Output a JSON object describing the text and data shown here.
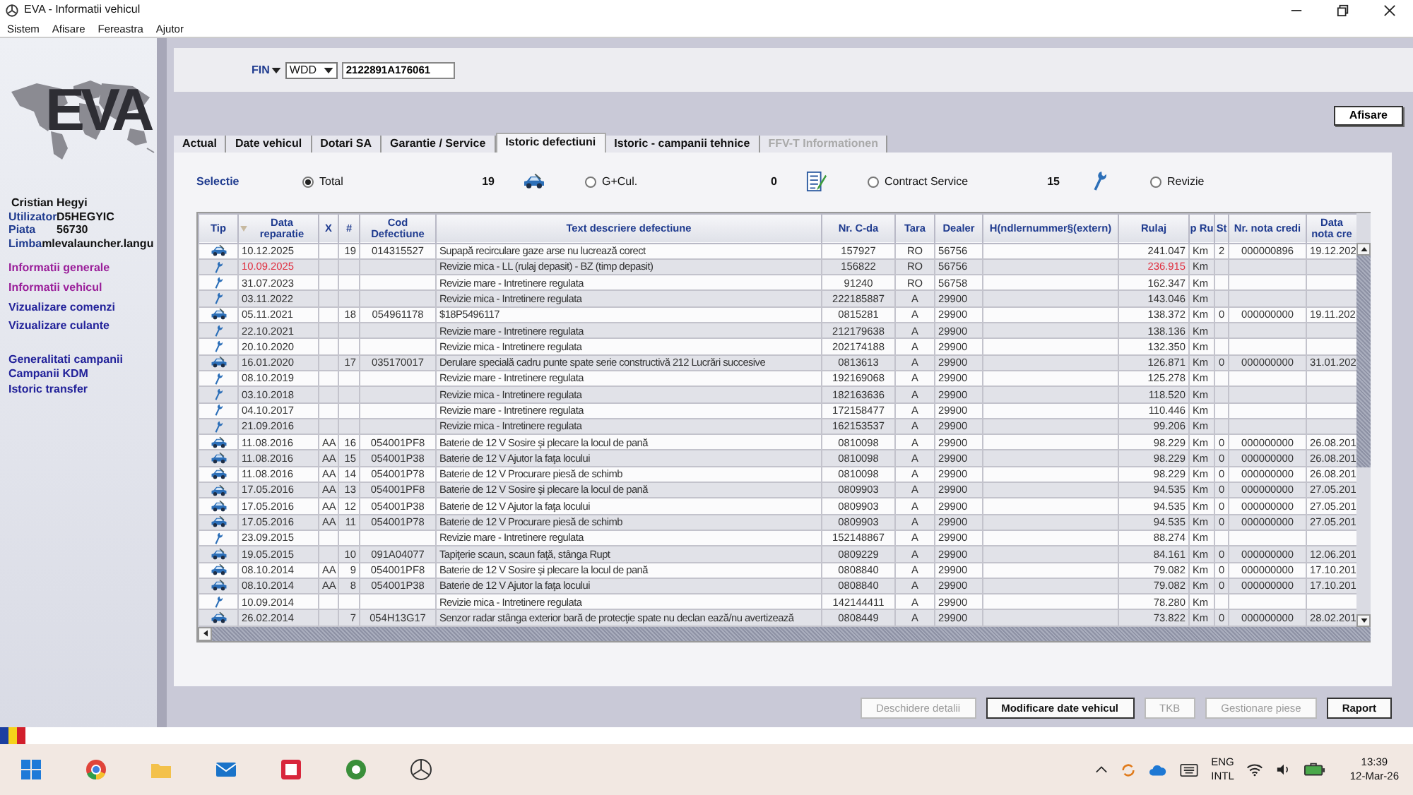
{
  "window": {
    "title": "EVA - Informatii vehicul"
  },
  "menu": [
    "Sistem",
    "Afisare",
    "Fereastra",
    "Ajutor"
  ],
  "sidebar": {
    "logo": "EVA",
    "user_name": "Cristian Hegyi",
    "fields": [
      {
        "label": "Utilizator",
        "value": "D5HEGYIC"
      },
      {
        "label": "Piata",
        "value": "56730"
      },
      {
        "label": "Limba",
        "value": "mlevalauncher.langu"
      }
    ],
    "nav_groups": [
      [
        {
          "label": "Informatii generale",
          "color": "#9a1f9a"
        },
        {
          "label": "Informatii vehicul",
          "color": "#9a1f9a"
        },
        {
          "label": "Vizualizare comenzi",
          "color": "#22229a"
        },
        {
          "label": "Vizualizare culante",
          "color": "#22229a"
        }
      ],
      [
        {
          "label": "Generalitati campanii",
          "color": "#22229a"
        },
        {
          "label": "Campanii KDM",
          "color": "#22229a"
        },
        {
          "label": "Istoric transfer",
          "color": "#22229a"
        }
      ]
    ]
  },
  "fin": {
    "label": "FIN",
    "prefix": "WDD",
    "value": "2122891A176061"
  },
  "show_button": "Afisare",
  "tabs": [
    {
      "label": "Actual",
      "selected": false,
      "disabled": false
    },
    {
      "label": "Date vehicul",
      "selected": false,
      "disabled": false
    },
    {
      "label": "Dotari SA",
      "selected": false,
      "disabled": false
    },
    {
      "label": "Garantie / Service",
      "selected": false,
      "disabled": false
    },
    {
      "label": "Istoric defectiuni",
      "selected": true,
      "disabled": false
    },
    {
      "label": "Istoric - campanii tehnice",
      "selected": false,
      "disabled": false
    },
    {
      "label": "FFV-T Informationen",
      "selected": false,
      "disabled": true
    }
  ],
  "selection": {
    "label": "Selectie",
    "options": [
      {
        "label": "Total",
        "selected": true,
        "count": "19"
      },
      {
        "label": "G+Cul.",
        "selected": false,
        "count": "0"
      },
      {
        "label": "Contract Service",
        "selected": false,
        "count": "15"
      },
      {
        "label": "Revizie",
        "selected": false
      }
    ]
  },
  "table": {
    "columns": [
      {
        "label": "Tip",
        "sorted": false
      },
      {
        "label": "Data reparatie",
        "sorted": true
      },
      {
        "label": "X",
        "sorted": false
      },
      {
        "label": "#",
        "sorted": false
      },
      {
        "label": "Cod Defectiune",
        "sorted": false
      },
      {
        "label": "Text descriere defectiune",
        "sorted": false
      },
      {
        "label": "Nr. C-da",
        "sorted": false
      },
      {
        "label": "Tara",
        "sorted": false
      },
      {
        "label": "Dealer",
        "sorted": false
      },
      {
        "label": "H(ndlernummer§(extern)",
        "sorted": false
      },
      {
        "label": "Rulaj",
        "sorted": false
      },
      {
        "label": "p Ru",
        "sorted": false
      },
      {
        "label": "St",
        "sorted": false
      },
      {
        "label": "Nr. nota credi",
        "sorted": false
      },
      {
        "label": "Data nota cre",
        "sorted": false
      }
    ],
    "rows": [
      {
        "kind": "defect",
        "alert": false,
        "date": "10.12.2025",
        "no": "19",
        "code": "014315527",
        "text": "Supapă recirculare gaze arse nu lucrează corect",
        "order": "157927",
        "country": "RO",
        "dealer": "56756",
        "mileage": "241.047",
        "unit": "Km",
        "st": "2",
        "credit_note": "000000896",
        "credit_date": "19.12.202"
      },
      {
        "kind": "service",
        "alert": true,
        "date": "10.09.2025",
        "text": "Revizie mica - LL (rulaj depasit) - BZ (timp depasit)",
        "order": "156822",
        "country": "RO",
        "dealer": "56756",
        "mileage": "236.915",
        "unit": "Km"
      },
      {
        "kind": "service",
        "alert": false,
        "date": "31.07.2023",
        "text": "Revizie mare - Intretinere regulata",
        "order": "91240",
        "country": "RO",
        "dealer": "56758",
        "mileage": "162.347",
        "unit": "Km"
      },
      {
        "kind": "service",
        "alert": false,
        "date": "03.11.2022",
        "text": "Revizie mica - Intretinere regulata",
        "order": "222185887",
        "country": "A",
        "dealer": "29900",
        "mileage": "143.046",
        "unit": "Km"
      },
      {
        "kind": "defect",
        "alert": false,
        "date": "05.11.2021",
        "no": "18",
        "code": "054961178",
        "text": "$18P5496117",
        "order": "0815281",
        "country": "A",
        "dealer": "29900",
        "mileage": "138.372",
        "unit": "Km",
        "st": "0",
        "credit_note": "000000000",
        "credit_date": "19.11.202"
      },
      {
        "kind": "service",
        "alert": false,
        "date": "22.10.2021",
        "text": "Revizie mare - Intretinere regulata",
        "order": "212179638",
        "country": "A",
        "dealer": "29900",
        "mileage": "138.136",
        "unit": "Km"
      },
      {
        "kind": "service",
        "alert": false,
        "date": "20.10.2020",
        "text": "Revizie mica - Intretinere regulata",
        "order": "202174188",
        "country": "A",
        "dealer": "29900",
        "mileage": "132.350",
        "unit": "Km"
      },
      {
        "kind": "defect",
        "alert": false,
        "date": "16.01.2020",
        "no": "17",
        "code": "035170017",
        "text": "Derulare specială cadru punte spate serie constructivă 212 Lucrări succesive",
        "order": "0813613",
        "country": "A",
        "dealer": "29900",
        "mileage": "126.871",
        "unit": "Km",
        "st": "0",
        "credit_note": "000000000",
        "credit_date": "31.01.202"
      },
      {
        "kind": "service",
        "alert": false,
        "date": "08.10.2019",
        "text": "Revizie mare - Intretinere regulata",
        "order": "192169068",
        "country": "A",
        "dealer": "29900",
        "mileage": "125.278",
        "unit": "Km"
      },
      {
        "kind": "service",
        "alert": false,
        "date": "03.10.2018",
        "text": "Revizie mica - Intretinere regulata",
        "order": "182163636",
        "country": "A",
        "dealer": "29900",
        "mileage": "118.520",
        "unit": "Km"
      },
      {
        "kind": "service",
        "alert": false,
        "date": "04.10.2017",
        "text": "Revizie mare - Intretinere regulata",
        "order": "172158477",
        "country": "A",
        "dealer": "29900",
        "mileage": "110.446",
        "unit": "Km"
      },
      {
        "kind": "service",
        "alert": false,
        "date": "21.09.2016",
        "text": "Revizie mica - Intretinere regulata",
        "order": "162153537",
        "country": "A",
        "dealer": "29900",
        "mileage": "99.206",
        "unit": "Km"
      },
      {
        "kind": "defect",
        "alert": false,
        "date": "11.08.2016",
        "x": "AA",
        "no": "16",
        "code": "054001PF8",
        "text": "Baterie de 12 V Sosire şi plecare la locul de pană",
        "order": "0810098",
        "country": "A",
        "dealer": "29900",
        "mileage": "98.229",
        "unit": "Km",
        "st": "0",
        "credit_note": "000000000",
        "credit_date": "26.08.201"
      },
      {
        "kind": "defect",
        "alert": false,
        "date": "11.08.2016",
        "x": "AA",
        "no": "15",
        "code": "054001P38",
        "text": "Baterie de 12 V Ajutor la faţa locului",
        "order": "0810098",
        "country": "A",
        "dealer": "29900",
        "mileage": "98.229",
        "unit": "Km",
        "st": "0",
        "credit_note": "000000000",
        "credit_date": "26.08.201"
      },
      {
        "kind": "defect",
        "alert": false,
        "date": "11.08.2016",
        "x": "AA",
        "no": "14",
        "code": "054001P78",
        "text": "Baterie de 12 V Procurare piesă de schimb",
        "order": "0810098",
        "country": "A",
        "dealer": "29900",
        "mileage": "98.229",
        "unit": "Km",
        "st": "0",
        "credit_note": "000000000",
        "credit_date": "26.08.201"
      },
      {
        "kind": "defect",
        "alert": false,
        "date": "17.05.2016",
        "x": "AA",
        "no": "13",
        "code": "054001PF8",
        "text": "Baterie de 12 V Sosire şi plecare la locul de pană",
        "order": "0809903",
        "country": "A",
        "dealer": "29900",
        "mileage": "94.535",
        "unit": "Km",
        "st": "0",
        "credit_note": "000000000",
        "credit_date": "27.05.201"
      },
      {
        "kind": "defect",
        "alert": false,
        "date": "17.05.2016",
        "x": "AA",
        "no": "12",
        "code": "054001P38",
        "text": "Baterie de 12 V Ajutor la faţa locului",
        "order": "0809903",
        "country": "A",
        "dealer": "29900",
        "mileage": "94.535",
        "unit": "Km",
        "st": "0",
        "credit_note": "000000000",
        "credit_date": "27.05.201"
      },
      {
        "kind": "defect",
        "alert": false,
        "date": "17.05.2016",
        "x": "AA",
        "no": "11",
        "code": "054001P78",
        "text": "Baterie de 12 V Procurare piesă de schimb",
        "order": "0809903",
        "country": "A",
        "dealer": "29900",
        "mileage": "94.535",
        "unit": "Km",
        "st": "0",
        "credit_note": "000000000",
        "credit_date": "27.05.201"
      },
      {
        "kind": "service",
        "alert": false,
        "date": "23.09.2015",
        "text": "Revizie mare - Intretinere regulata",
        "order": "152148867",
        "country": "A",
        "dealer": "29900",
        "mileage": "88.274",
        "unit": "Km"
      },
      {
        "kind": "defect",
        "alert": false,
        "date": "19.05.2015",
        "no": "10",
        "code": "091A04077",
        "text": "Tapiţerie scaun, scaun faţă, stânga Rupt",
        "order": "0809229",
        "country": "A",
        "dealer": "29900",
        "mileage": "84.161",
        "unit": "Km",
        "st": "0",
        "credit_note": "000000000",
        "credit_date": "12.06.201"
      },
      {
        "kind": "defect",
        "alert": false,
        "date": "08.10.2014",
        "x": "AA",
        "no": "9",
        "code": "054001PF8",
        "text": "Baterie de 12 V Sosire şi plecare la locul de pană",
        "order": "0808840",
        "country": "A",
        "dealer": "29900",
        "mileage": "79.082",
        "unit": "Km",
        "st": "0",
        "credit_note": "000000000",
        "credit_date": "17.10.201"
      },
      {
        "kind": "defect",
        "alert": false,
        "date": "08.10.2014",
        "x": "AA",
        "no": "8",
        "code": "054001P38",
        "text": "Baterie de 12 V Ajutor la faţa locului",
        "order": "0808840",
        "country": "A",
        "dealer": "29900",
        "mileage": "79.082",
        "unit": "Km",
        "st": "0",
        "credit_note": "000000000",
        "credit_date": "17.10.201"
      },
      {
        "kind": "service",
        "alert": false,
        "date": "10.09.2014",
        "text": "Revizie mica - Intretinere regulata",
        "order": "142144411",
        "country": "A",
        "dealer": "29900",
        "mileage": "78.280",
        "unit": "Km"
      },
      {
        "kind": "defect",
        "alert": false,
        "date": "26.02.2014",
        "no": "7",
        "code": "054H13G17",
        "text": "Senzor radar stânga exterior bară de protecţie spate nu declan ează/nu avertizează",
        "order": "0808449",
        "country": "A",
        "dealer": "29900",
        "mileage": "73.822",
        "unit": "Km",
        "st": "0",
        "credit_note": "000000000",
        "credit_date": "28.02.201"
      }
    ]
  },
  "buttons": [
    {
      "label": "Deschidere detalii",
      "disabled": true
    },
    {
      "label": "Modificare date vehicul",
      "disabled": false
    },
    {
      "label": "TKB",
      "disabled": true
    },
    {
      "label": "Gestionare piese",
      "disabled": true
    },
    {
      "label": "Raport",
      "disabled": false
    }
  ],
  "taskbar": {
    "language": "ENG",
    "layout": "INTL",
    "time": "13:39",
    "date": "12-Mar-26"
  }
}
